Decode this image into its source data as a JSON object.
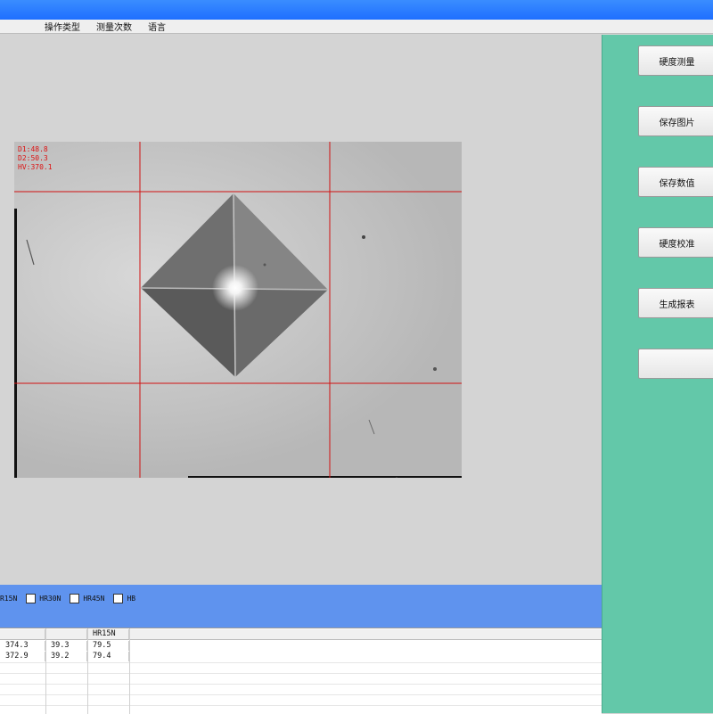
{
  "menu": {
    "items": [
      "",
      "",
      "操作类型",
      "测量次数",
      "语言"
    ]
  },
  "side_buttons": [
    "硬度测量",
    "保存图片",
    "保存数值",
    "硬度校准",
    "生成报表",
    ""
  ],
  "readout": {
    "d1": "D1:48.8",
    "d2": "D2:50.3",
    "hv": "HV:370.1"
  },
  "scales": [
    "R15N",
    "HR30N",
    "HR45N",
    "HB"
  ],
  "table": {
    "headers": [
      "",
      "",
      "HR15N"
    ],
    "rows": [
      [
        "374.3",
        "39.3",
        "79.5"
      ],
      [
        "372.9",
        "39.2",
        "79.4"
      ]
    ]
  },
  "colors": {
    "accent_green": "#63c8a9",
    "title_blue": "#1f6fff",
    "bar_blue": "#5f93ee",
    "crosshair_red": "#d11111"
  }
}
